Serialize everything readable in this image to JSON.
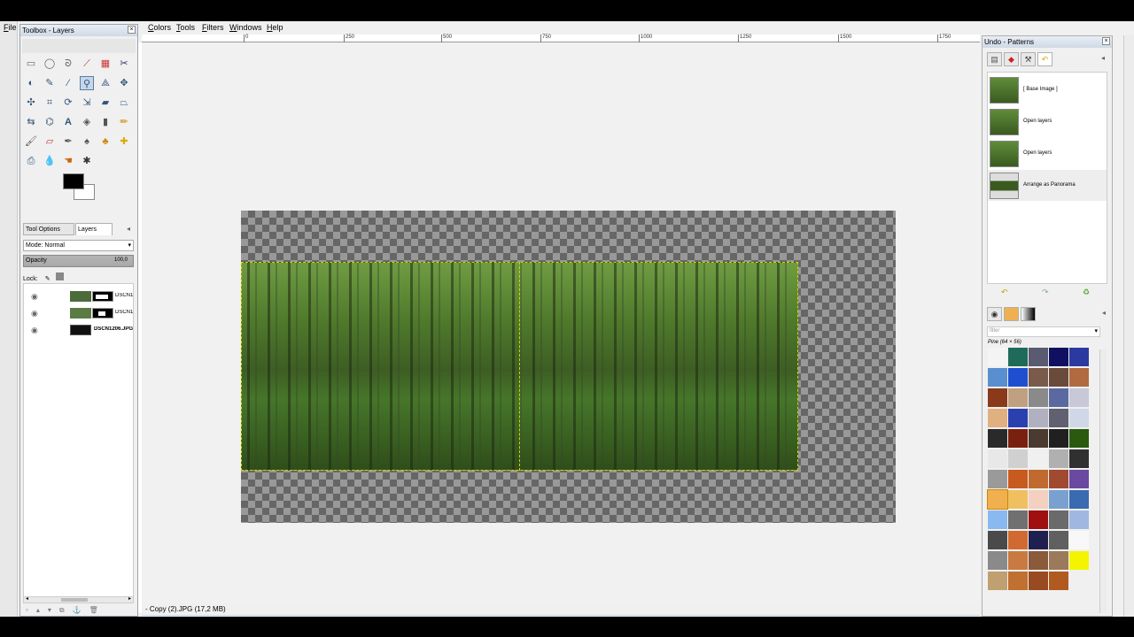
{
  "menubar": {
    "file": "File",
    "colors": "Colors",
    "tools": "Tools",
    "filters": "Filters",
    "windows": "Windows",
    "help": "Help"
  },
  "toolbox": {
    "title": "Toolbox - Layers",
    "tabs": [
      "Tool Options",
      "Layers"
    ],
    "mode_label": "Mode: Normal",
    "opacity_label": "Opacity",
    "opacity_value": "100,0",
    "lock_label": "Lock:",
    "layers": [
      {
        "name": "DSCN1",
        "thumb": "#4c6b3a"
      },
      {
        "name": "DSCN1",
        "thumb": "#5b7b45"
      },
      {
        "name": "DSCN1206.JPG",
        "thumb": "#1b2a12"
      }
    ]
  },
  "ruler": {
    "ticks": [
      "0",
      "250",
      "500",
      "750",
      "1000",
      "1250",
      "1500",
      "1750"
    ]
  },
  "statusbar": {
    "text": "- Copy (2).JPG (17,2 MB)"
  },
  "undo": {
    "title": "Undo - Patterns",
    "items": [
      {
        "label": "[ Base Image ]"
      },
      {
        "label": "Open layers"
      },
      {
        "label": "Open layers"
      },
      {
        "label": "Arrange as Panorama"
      }
    ]
  },
  "patterns": {
    "filter_placeholder": "filter",
    "selected_name": "Pine (64 × 56)",
    "colors": [
      "#f4f4f4",
      "#1f6b5a",
      "#5a5a70",
      "#101060",
      "#2a3aa0",
      "#5a8fcf",
      "#1f4fd0",
      "#7a5a4a",
      "#6a4a3a",
      "#b06a40",
      "#8a3a1a",
      "#c0a080",
      "#8a8a8a",
      "#5a6aa0",
      "#c8c8d8",
      "#e0b080",
      "#2a40b0",
      "#b0b0c0",
      "#606070",
      "#d0d8e8",
      "#2a2a2a",
      "#7a2010",
      "#4a3a30",
      "#202020",
      "#2a5a10",
      "#e8e8e8",
      "#d0d0d0",
      "#f0f0f0",
      "#b0b0b0",
      "#303030",
      "#9a9a9a",
      "#c85a20",
      "#c06a30",
      "#a04a30",
      "#6a4aa0",
      "#f0b050",
      "#f0c060",
      "#f4d0c0",
      "#7aa0d0",
      "#3a6ab0",
      "#8ab8f0",
      "#707070",
      "#a01010",
      "#6a6a6a",
      "#a0b8e0",
      "#4a4a4a",
      "#d06a30",
      "#202050",
      "#606060",
      "#f8f8f8",
      "#8a8a8a",
      "#c87a40",
      "#8a5a3a",
      "#9a7a5a",
      "#f4f400",
      "#c0a070",
      "#c07030",
      "#9a4a20",
      "#b05a20",
      "#f0f0f0"
    ]
  }
}
